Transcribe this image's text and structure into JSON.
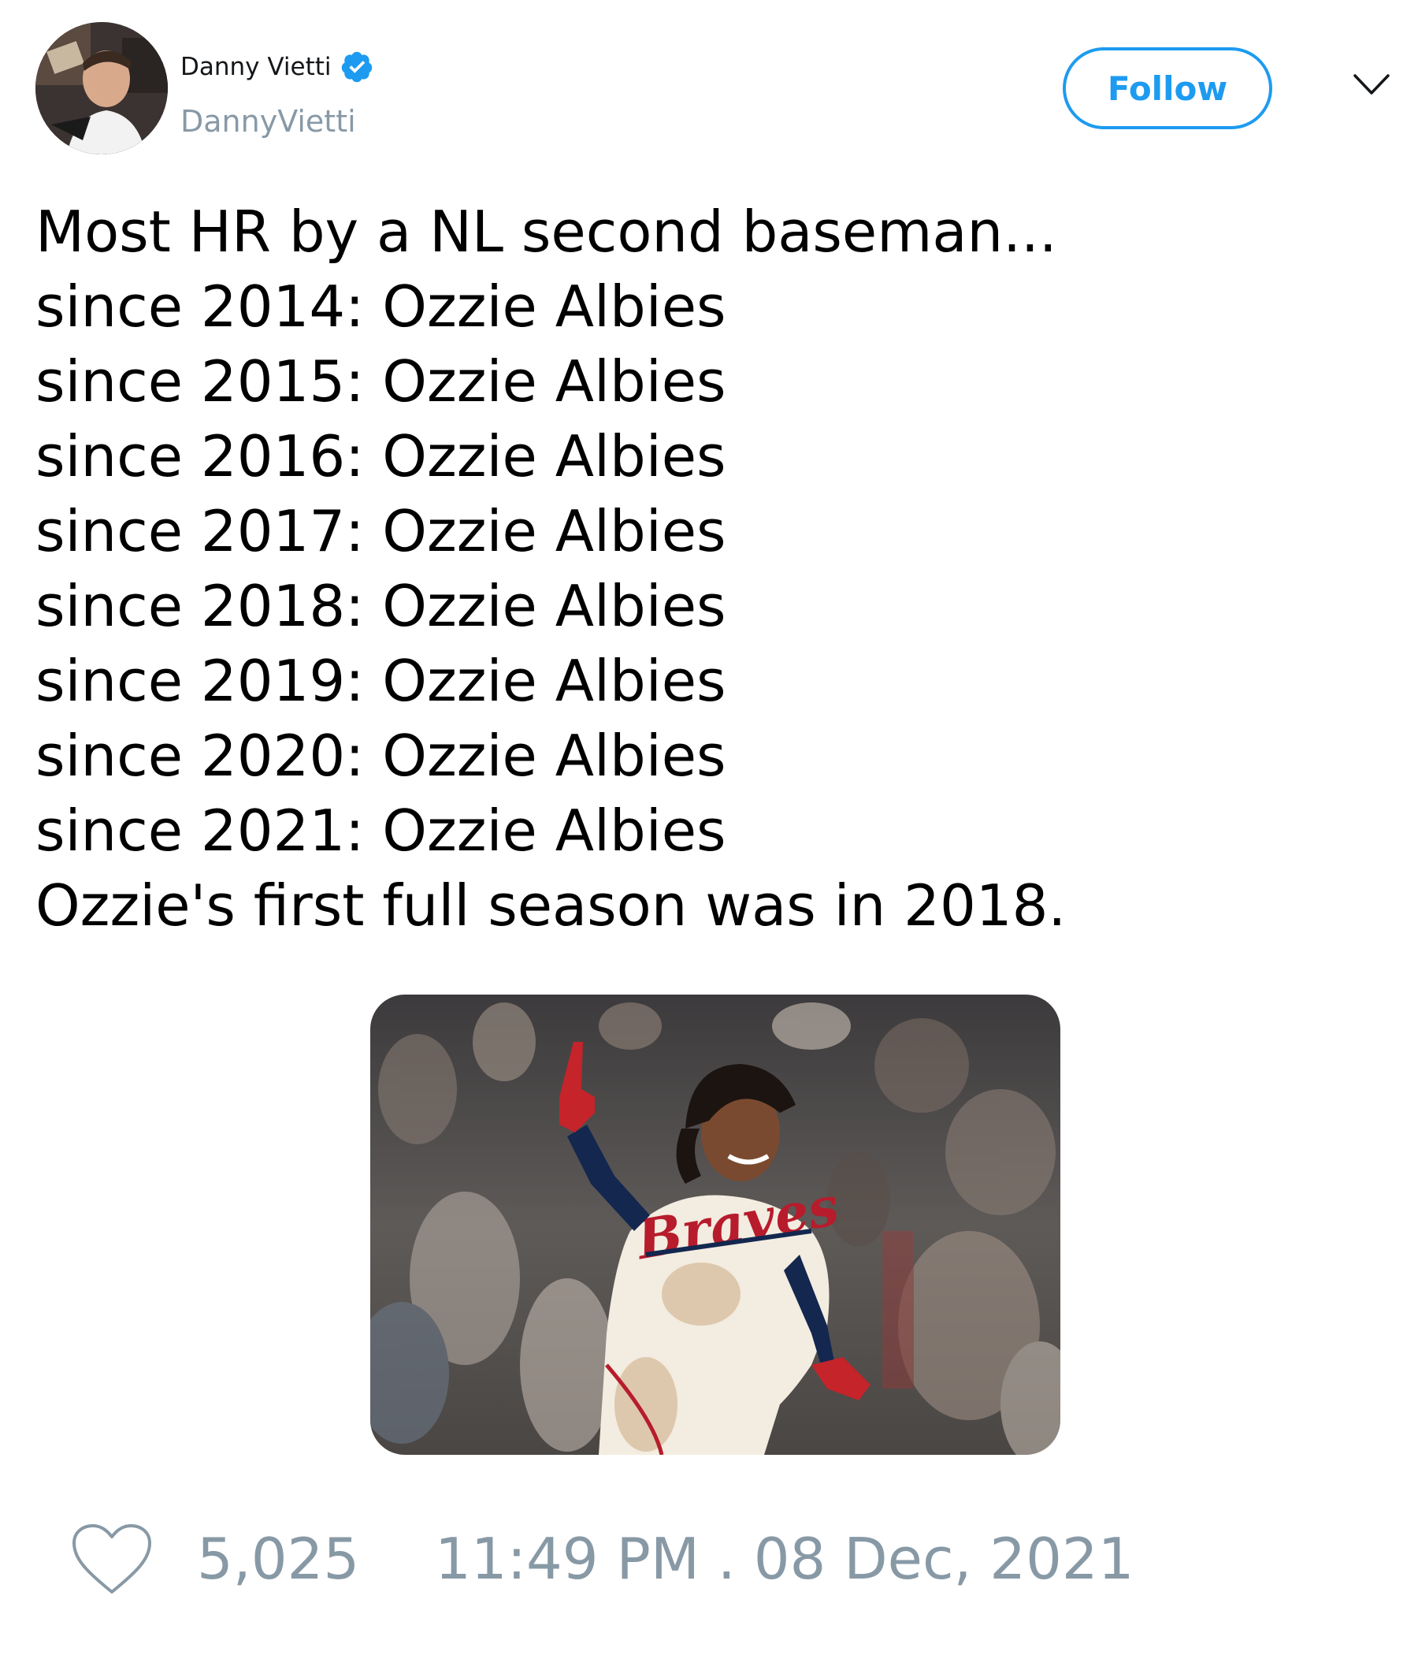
{
  "user": {
    "display_name": "Danny Vietti",
    "handle": "DannyVietti",
    "verified_icon": "verified-badge-icon"
  },
  "follow_label": "Follow",
  "tweet": {
    "lines": [
      "Most HR by a NL second baseman...",
      "since 2014: Ozzie Albies",
      "since 2015: Ozzie Albies",
      "since 2016: Ozzie Albies",
      "since 2017: Ozzie Albies",
      "since 2018: Ozzie Albies",
      "since 2019: Ozzie Albies",
      "since 2020: Ozzie Albies",
      "since 2021: Ozzie Albies",
      "Ozzie's first full season was in 2018."
    ]
  },
  "footer": {
    "like_count": "5,025",
    "timestamp": "11:49 PM . 08 Dec, 2021"
  },
  "colors": {
    "accent": "#1d9bf0",
    "muted": "#8899a6",
    "text": "#000000"
  }
}
